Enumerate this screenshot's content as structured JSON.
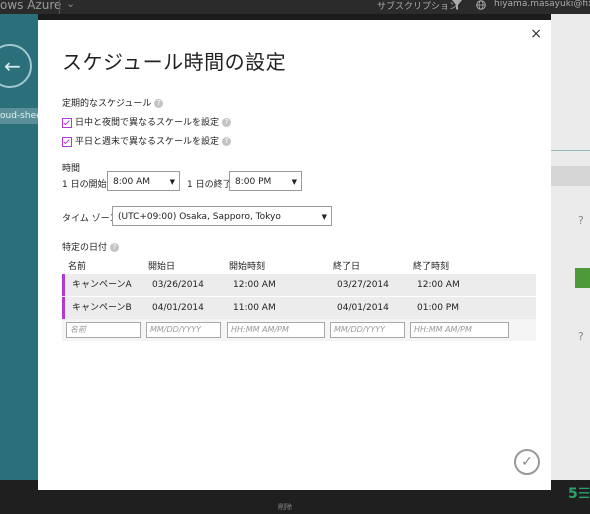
{
  "topbar": {
    "brand": "ows Azure",
    "subscription": "サブスクリプション",
    "user": "hiyama.masayuki@fixer.co",
    "icons": [
      "chevron-down-icon",
      "funnel-icon",
      "globe-icon"
    ]
  },
  "leftnav": {
    "item": "oud-sheep"
  },
  "bottombar": {
    "label": "削除"
  },
  "dialog": {
    "title": "スケジュール時間の設定",
    "close": "×",
    "periodic_label": "定期的なスケジュール",
    "help": "?",
    "checkbox_daynight": "日中と夜間で異なるスケールを設定",
    "checkbox_weekday": "平日と週末で異なるスケールを設定",
    "time_label": "時間",
    "start_label": "1 日の開始:",
    "start_value": "8:00 AM",
    "end_label": "1 日の終了:",
    "end_value": "8:00 PM",
    "timezone_label": "タイム ゾーン:",
    "timezone_value": "(UTC+09:00) Osaka, Sapporo, Tokyo",
    "specific_dates_label": "特定の日付",
    "columns": [
      "名前",
      "開始日",
      "開始時刻",
      "終了日",
      "終了時刻"
    ],
    "rows": [
      {
        "name": "キャンペーンA",
        "start_date": "03/26/2014",
        "start_time": "12:00 AM",
        "end_date": "03/27/2014",
        "end_time": "12:00 AM"
      },
      {
        "name": "キャンペーンB",
        "start_date": "04/01/2014",
        "start_time": "11:00 AM",
        "end_date": "04/01/2014",
        "end_time": "01:00 PM"
      }
    ],
    "placeholders": {
      "name": "名前",
      "start_date": "MM/DD/YYYY",
      "start_time": "HH:MM AM/PM",
      "end_date": "MM/DD/YYYY",
      "end_time": "HH:MM AM/PM"
    },
    "ok": "✓",
    "accent_color": "#b13ad4"
  }
}
